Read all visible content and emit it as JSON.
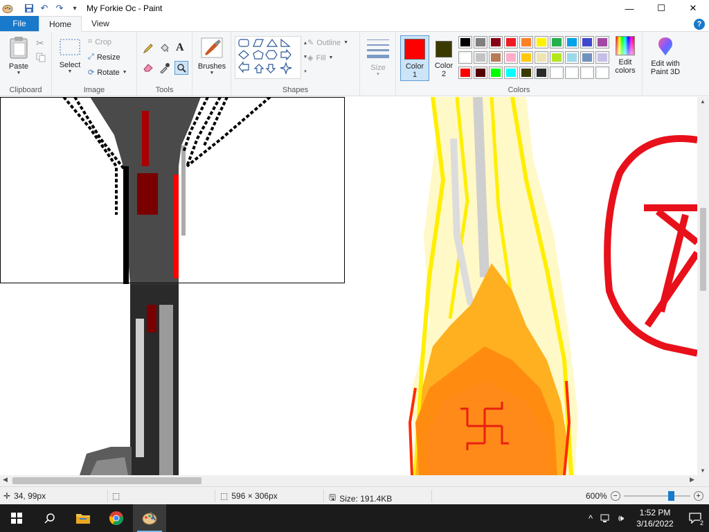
{
  "window": {
    "title": "My Forkie Oc - Paint",
    "controls": {
      "minimize": "—",
      "maximize": "☐",
      "close": "✕"
    },
    "quick_access": {
      "save": "💾",
      "undo": "↶",
      "redo": "↷",
      "customize": "▾"
    }
  },
  "tabs": {
    "file": "File",
    "home": "Home",
    "view": "View",
    "help": "?"
  },
  "ribbon": {
    "clipboard": {
      "label": "Clipboard",
      "paste": "Paste"
    },
    "image": {
      "label": "Image",
      "select": "Select",
      "crop": "Crop",
      "resize": "Resize",
      "rotate": "Rotate"
    },
    "tools": {
      "label": "Tools"
    },
    "brushes": {
      "label": "Brushes"
    },
    "shapes": {
      "label": "Shapes",
      "outline": "Outline",
      "fill": "Fill"
    },
    "size": {
      "label": "Size"
    },
    "colors": {
      "label": "Colors",
      "color1_label": "Color\n1",
      "color1_line1": "Color",
      "color1_line2": "1",
      "color2_line1": "Color",
      "color2_line2": "2",
      "color1": "#ff0000",
      "color2": "#3a3a00",
      "edit_line1": "Edit",
      "edit_line2": "colors",
      "palette_row1": [
        "#000000",
        "#7f7f7f",
        "#880015",
        "#ed1c24",
        "#ff7f27",
        "#fff200",
        "#22b14c",
        "#00a2e8",
        "#3f48cc",
        "#a349a4"
      ],
      "palette_row2": [
        "#ffffff",
        "#c3c3c3",
        "#b97a57",
        "#ffaec9",
        "#ffc90e",
        "#efe4b0",
        "#b5e61d",
        "#99d9ea",
        "#7092be",
        "#c8bfe7"
      ],
      "palette_row3": [
        "#ff0000",
        "#550000",
        "#00ff00",
        "#00ffff",
        "#3a3a00",
        "#2b2b2b",
        "#ffffff",
        "#ffffff",
        "#ffffff",
        "#ffffff"
      ]
    },
    "paint3d": {
      "line1": "Edit with",
      "line2": "Paint 3D"
    }
  },
  "statusbar": {
    "cursor_pos": "34, 99px",
    "selection_size": "596 × 306px",
    "file_size": "Size: 191.4KB",
    "zoom": "600%"
  },
  "taskbar": {
    "time": "1:52 PM",
    "date": "3/16/2022",
    "notifications": "2"
  }
}
